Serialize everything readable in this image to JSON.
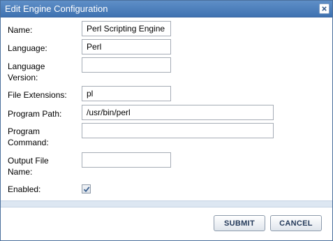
{
  "dialog": {
    "title": "Edit Engine Configuration"
  },
  "form": {
    "name": {
      "label": "Name:",
      "value": "Perl Scripting Engine"
    },
    "language": {
      "label": "Language:",
      "value": "Perl"
    },
    "language_version": {
      "label_line1": "Language",
      "label_line2": "Version:",
      "value": ""
    },
    "file_extensions": {
      "label": "File Extensions:",
      "value": "pl"
    },
    "program_path": {
      "label": "Program Path:",
      "value": "/usr/bin/perl"
    },
    "program_command": {
      "label_line1": "Program",
      "label_line2": "Command:",
      "value": ""
    },
    "output_file_name": {
      "label_line1": "Output File",
      "label_line2": "Name:",
      "value": ""
    },
    "enabled": {
      "label": "Enabled:",
      "checked": true
    }
  },
  "buttons": {
    "submit": "SUBMIT",
    "cancel": "CANCEL"
  },
  "colors": {
    "titlebar": "#3f72b1",
    "checkmark": "#3a5f8f"
  },
  "icons": {
    "close": "close-icon",
    "check": "checkmark-icon"
  }
}
